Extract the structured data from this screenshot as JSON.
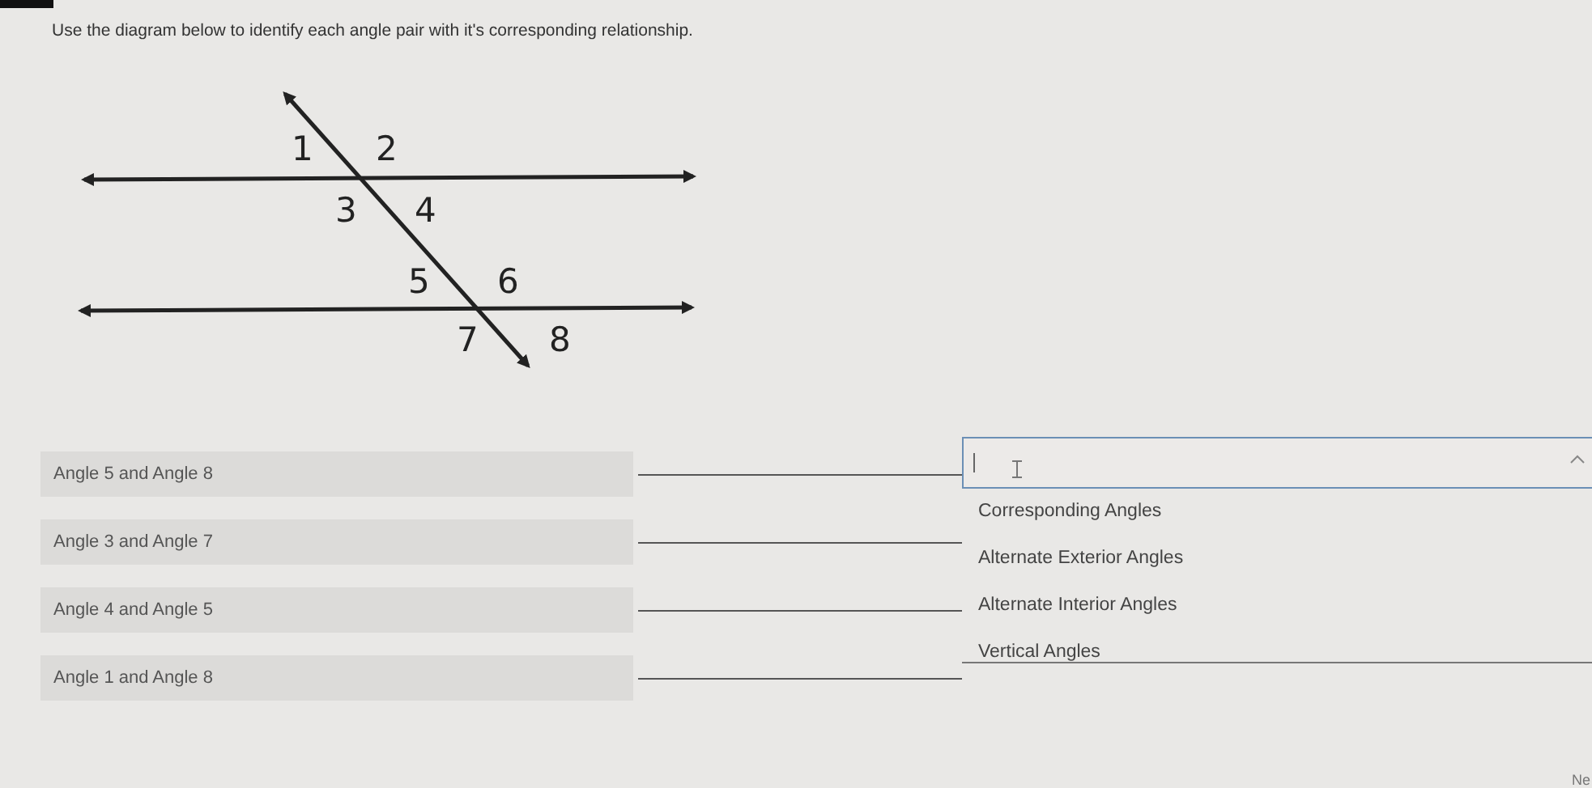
{
  "instruction": "Use the diagram below to identify each angle pair with it's corresponding relationship.",
  "diagram": {
    "angle_labels": [
      "1",
      "2",
      "3",
      "4",
      "5",
      "6",
      "7",
      "8"
    ]
  },
  "pairs": [
    {
      "label": "Angle 5 and Angle 8"
    },
    {
      "label": "Angle 3 and Angle 7"
    },
    {
      "label": "Angle 4 and Angle 5"
    },
    {
      "label": "Angle 1 and Angle 8"
    }
  ],
  "dropdown": {
    "expanded": true,
    "options": [
      "Corresponding Angles",
      "Alternate Exterior Angles",
      "Alternate Interior Angles",
      "Vertical Angles"
    ]
  },
  "next_button": {
    "label": "Ne"
  }
}
